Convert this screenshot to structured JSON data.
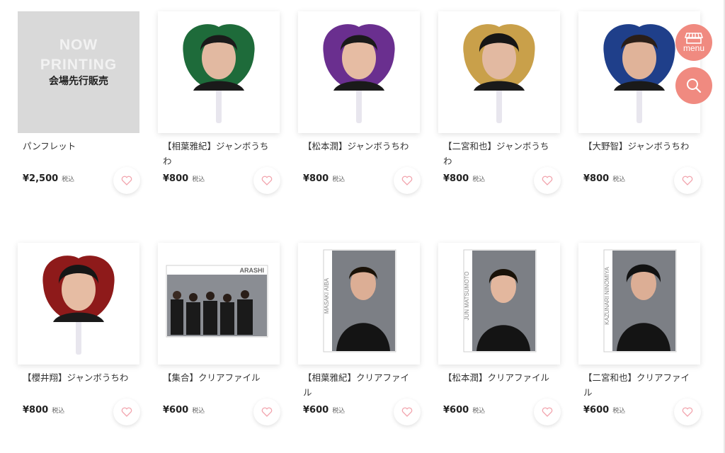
{
  "currency_tax_label": "税込",
  "placeholder": {
    "line1": "NOW",
    "line2": "PRINTING",
    "line3": "会場先行販売"
  },
  "nav": {
    "menu_label": "menu"
  },
  "products": [
    {
      "title": "パンフレット",
      "price": "¥2,500",
      "kind": "placeholder"
    },
    {
      "title": "【相葉雅紀】ジャンボうちわ",
      "price": "¥800",
      "kind": "fan",
      "bg": "#1e6b3a"
    },
    {
      "title": "【松本潤】ジャンボうちわ",
      "price": "¥800",
      "kind": "fan",
      "bg": "#6a2f8f"
    },
    {
      "title": "【二宮和也】ジャンボうちわ",
      "price": "¥800",
      "kind": "fan",
      "bg": "#c9a04a"
    },
    {
      "title": "【大野智】ジャンボうちわ",
      "price": "¥800",
      "kind": "fan",
      "bg": "#1f3f8a"
    },
    {
      "title": "【櫻井翔】ジャンボうちわ",
      "price": "¥800",
      "kind": "fan",
      "bg": "#8e1a1a"
    },
    {
      "title": "【集合】クリアファイル",
      "price": "¥600",
      "kind": "group-file",
      "brand": "ARASHI"
    },
    {
      "title": "【相葉雅紀】クリアファイル",
      "price": "¥600",
      "kind": "file",
      "name_vertical": "MASAKI AIBA"
    },
    {
      "title": "【松本潤】クリアファイル",
      "price": "¥600",
      "kind": "file",
      "name_vertical": "JUN MATSUMOTO"
    },
    {
      "title": "【二宮和也】クリアファイル",
      "price": "¥600",
      "kind": "file",
      "name_vertical": "KAZUNARI NINOMIYA"
    }
  ]
}
